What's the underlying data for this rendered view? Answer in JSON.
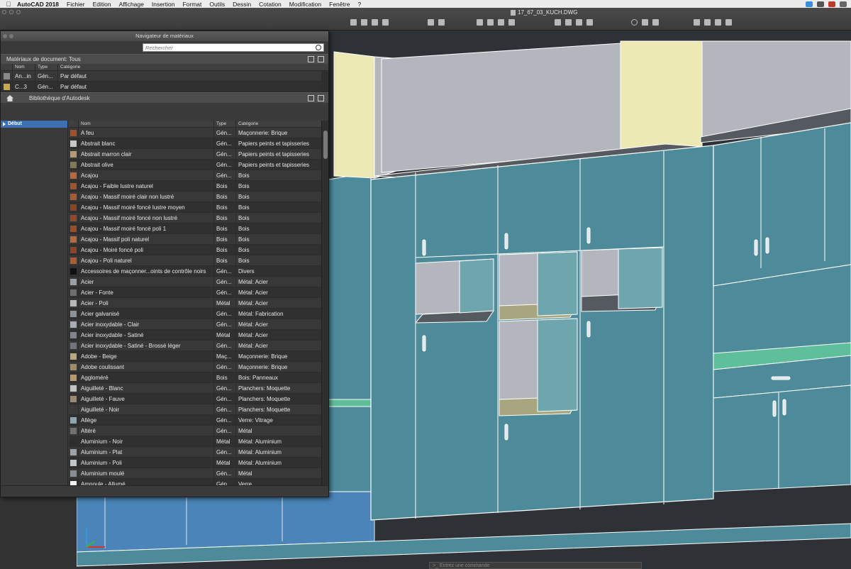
{
  "menubar": {
    "app": "AutoCAD 2018",
    "items": [
      "Fichier",
      "Edition",
      "Affichage",
      "Insertion",
      "Format",
      "Outils",
      "Dessin",
      "Cotation",
      "Modification",
      "Fenêtre",
      "?"
    ]
  },
  "window": {
    "document_title": "17_67_03_KUCH.DWG"
  },
  "palette": {
    "title": "Navigateur de matériaux",
    "search_placeholder": "Rechercher",
    "doc_section_label": "Matériaux de document: Tous",
    "doc_columns": [
      "Nom",
      "Type",
      "Catégorie"
    ],
    "doc_rows": [
      {
        "name": "An...in",
        "type": "Gén...",
        "category": "Par défaut",
        "swatch": "#8a8a8a"
      },
      {
        "name": "C...3",
        "type": "Gén...",
        "category": "Par défaut",
        "swatch": "#c9a84a"
      }
    ],
    "library_label": "Bibliothèque d'Autodesk",
    "tree_root": "Début",
    "lib_columns": [
      "Nom",
      "Type",
      "Catégorie"
    ],
    "lib_rows": [
      {
        "name": "A feu",
        "type": "Gén...",
        "category": "Maçonnerie: Brique",
        "swatch": "#a0522d"
      },
      {
        "name": "Abstrait blanc",
        "type": "Gén...",
        "category": "Papiers peints et tapisseries",
        "swatch": "#c8c8c8"
      },
      {
        "name": "Abstrait marron clair",
        "type": "Gén...",
        "category": "Papiers peints et tapisseries",
        "swatch": "#b59a72"
      },
      {
        "name": "Abstrait olive",
        "type": "Gén...",
        "category": "Papiers peints et tapisseries",
        "swatch": "#7d7a55"
      },
      {
        "name": "Acajou",
        "type": "Gén...",
        "category": "Bois",
        "swatch": "#b4693e"
      },
      {
        "name": "Acajou - Faible lustre naturel",
        "type": "Bois",
        "category": "Bois",
        "swatch": "#9c5530"
      },
      {
        "name": "Acajou - Massif moiré clair non lustré",
        "type": "Bois",
        "category": "Bois",
        "swatch": "#a65d34"
      },
      {
        "name": "Acajou - Massif moiré foncé lustre moyen",
        "type": "Bois",
        "category": "Bois",
        "swatch": "#8a4527"
      },
      {
        "name": "Acajou - Massif moiré foncé non lustré",
        "type": "Bois",
        "category": "Bois",
        "swatch": "#8f4a2a"
      },
      {
        "name": "Acajou - Massif moiré foncé poli 1",
        "type": "Bois",
        "category": "Bois",
        "swatch": "#9a4f2c"
      },
      {
        "name": "Acajou - Massif poli naturel",
        "type": "Bois",
        "category": "Bois",
        "swatch": "#b36a3d"
      },
      {
        "name": "Acajou - Moiré foncé poli",
        "type": "Bois",
        "category": "Bois",
        "swatch": "#8c4428"
      },
      {
        "name": "Acajou - Poli naturel",
        "type": "Bois",
        "category": "Bois",
        "swatch": "#a85d35"
      },
      {
        "name": "Accessoires de maçonner...oints de contrôle noirs",
        "type": "Gén...",
        "category": "Divers",
        "swatch": "#111111"
      },
      {
        "name": "Acier",
        "type": "Gén...",
        "category": "Métal: Acier",
        "swatch": "#9aa0a6"
      },
      {
        "name": "Acier - Fonte",
        "type": "Gén...",
        "category": "Métal: Acier",
        "swatch": "#6e6e6e"
      },
      {
        "name": "Acier - Poli",
        "type": "Métal",
        "category": "Métal: Acier",
        "swatch": "#b8b8b8"
      },
      {
        "name": "Acier galvanisé",
        "type": "Gén...",
        "category": "Métal: Fabrication",
        "swatch": "#8d9296"
      },
      {
        "name": "Acier inoxydable - Clair",
        "type": "Gén...",
        "category": "Métal: Acier",
        "swatch": "#a8aeb3"
      },
      {
        "name": "Acier inoxydable - Satiné",
        "type": "Métal",
        "category": "Métal: Acier",
        "swatch": "#7f858a"
      },
      {
        "name": "Acier inoxydable - Satiné - Brossé léger",
        "type": "Gén...",
        "category": "Métal: Acier",
        "swatch": "#6f757a"
      },
      {
        "name": "Adobe - Beige",
        "type": "Maç...",
        "category": "Maçonnerie: Brique",
        "swatch": "#b9a882"
      },
      {
        "name": "Adobe coulissant",
        "type": "Gén...",
        "category": "Maçonnerie: Brique",
        "swatch": "#a18a66"
      },
      {
        "name": "Aggloméré",
        "type": "Bois",
        "category": "Bois: Panneaux",
        "swatch": "#b69b6e"
      },
      {
        "name": "Aiguilleté - Blanc",
        "type": "Gén...",
        "category": "Planchers: Moquette",
        "swatch": "#c4c4c4"
      },
      {
        "name": "Aiguilleté - Fauve",
        "type": "Gén...",
        "category": "Planchers: Moquette",
        "swatch": "#9a8a70"
      },
      {
        "name": "Aiguilleté - Noir",
        "type": "Gén...",
        "category": "Planchers: Moquette",
        "swatch": "#3a3a3a"
      },
      {
        "name": "Allège",
        "type": "Gén...",
        "category": "Verre: Vitrage",
        "swatch": "#8ea4b0"
      },
      {
        "name": "Altéré",
        "type": "Gén...",
        "category": "Métal",
        "swatch": "#707070"
      },
      {
        "name": "Aluminium - Noir",
        "type": "Métal",
        "category": "Métal: Aluminium",
        "swatch": "#2d2d2d"
      },
      {
        "name": "Aluminium - Plat",
        "type": "Gén...",
        "category": "Métal: Aluminium",
        "swatch": "#9ea3a7"
      },
      {
        "name": "Aluminium - Poli",
        "type": "Métal",
        "category": "Métal: Aluminium",
        "swatch": "#c2c6c9"
      },
      {
        "name": "Aluminium moulé",
        "type": "Gén...",
        "category": "Métal",
        "swatch": "#8a8e92"
      },
      {
        "name": "Ampoule - Allumé",
        "type": "Gén...",
        "category": "Verre",
        "swatch": "#f2f2f2"
      }
    ]
  },
  "command_line": {
    "placeholder": "Entrez une commande"
  },
  "colors": {
    "cabinet": "#4d8b9b",
    "cabinet_dark": "#3f7886",
    "wall": "#b4b6bd",
    "yellow_panel": "#ece9b4",
    "counter_green": "#5fbf9a",
    "selection_blue": "#3d6fb5"
  }
}
